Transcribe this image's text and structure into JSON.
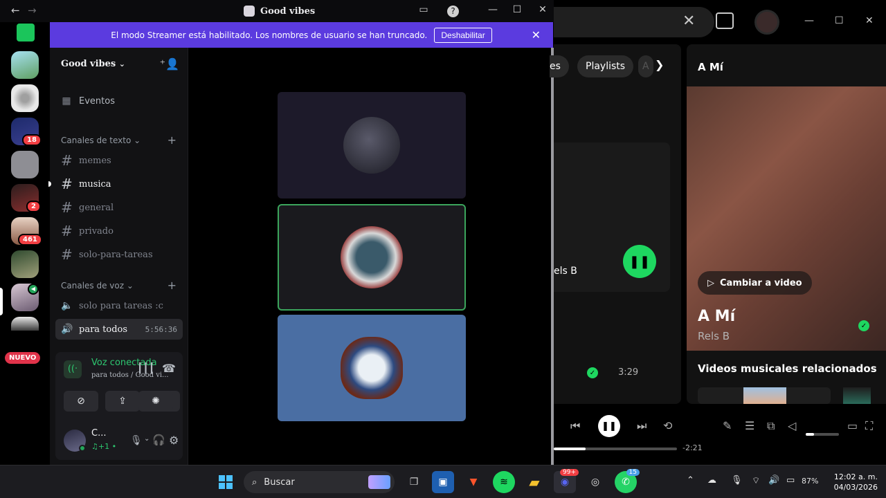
{
  "discord": {
    "window_title": "Good vibes",
    "banner": {
      "text": "El modo Streamer está habilitado. Los nombres de usuario se han truncado.",
      "button": "Deshabilitar"
    },
    "rail": {
      "badges": [
        "18",
        "2",
        "461"
      ],
      "new_label": "NUEVO"
    },
    "guild_name": "Good vibes",
    "events_label": "Eventos",
    "text_header": "Canales de texto",
    "text_channels": [
      "memes",
      "musica",
      "general",
      "privado",
      "solo-para-tareas"
    ],
    "voice_header": "Canales de voz",
    "voice_channels": [
      "solo para tareas :c",
      "para todos"
    ],
    "voice_timer": "5:56:36",
    "voice_panel": {
      "status": "Voz conectada",
      "subtitle": "para todos / Good vi..."
    },
    "user": {
      "name": "C...",
      "activity": "♫+1 •"
    },
    "colors": {
      "accent": "#5b3bdf",
      "connected": "#2dc770",
      "speaking_border": "#3ba55c"
    }
  },
  "spotify": {
    "chips": [
      "es",
      "Playlists",
      "A"
    ],
    "left_track_artist": "els B",
    "left_track_duration": "3:29",
    "now_playing_header": "A Mí",
    "video_button": "Cambiar a video",
    "title": "A Mí",
    "artist": "Rels B",
    "related_header": "Videos musicales relacionados",
    "remaining_time": "-2:21",
    "progress_fraction": 0.26,
    "volume_fraction": 0.25,
    "accent": "#1ed760"
  },
  "taskbar": {
    "search_label": "Buscar",
    "whatsapp_badge": "15",
    "discord_badge": "99+",
    "battery": "87%",
    "time": "12:02 a. m.",
    "date": "04/03/2026"
  }
}
